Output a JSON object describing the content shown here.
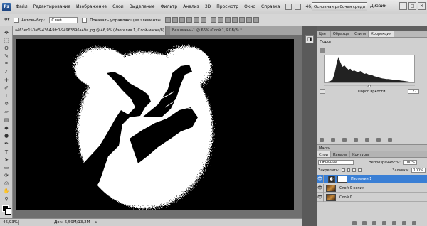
{
  "menubar": {
    "logo": "Ps",
    "items": [
      "Файл",
      "Редактирование",
      "Изображение",
      "Слои",
      "Выделение",
      "Фильтр",
      "Анализ",
      "3D",
      "Просмотр",
      "Окно",
      "Справка"
    ],
    "zoom": "46,9",
    "workspace_button": "Основная рабочая среда",
    "workspace_link": "Дизайн",
    "more": "»",
    "win_buttons": [
      "–",
      "□",
      "×"
    ]
  },
  "optbar": {
    "autoselect_label": "Автовыбор:",
    "autoselect_value": "Слой",
    "show_controls_label": "Показать управляющие элементы"
  },
  "toolbar": {
    "tools": [
      "move-tool",
      "marquee-tool",
      "lasso-tool",
      "quick-select-tool",
      "crop-tool",
      "eyedropper-tool",
      "healing-tool",
      "brush-tool",
      "stamp-tool",
      "history-brush-tool",
      "eraser-tool",
      "gradient-tool",
      "blur-tool",
      "dodge-tool",
      "pen-tool",
      "type-tool",
      "path-select-tool",
      "shape-tool",
      "3d-rotate-tool",
      "3d-orbit-tool",
      "hand-tool",
      "zoom-tool"
    ]
  },
  "document": {
    "tab_title": "a463ec1f-0af5-4364-9fc0-94963396a49a.jpg @ 46,9% (Изогелия 1, Слой-маска/8) *",
    "tab2_title": "Без имени-1 @ 66% (Слой 1, RGB/8) *"
  },
  "statusbar": {
    "zoom": "46,93%",
    "doc_info": "Док: 6,59M/13,2M"
  },
  "right_panel": {
    "tabs": [
      "Цвет",
      "Образцы",
      "Стили",
      "Коррекция"
    ],
    "active_tab": "Коррекция",
    "threshold_title": "Порог",
    "threshold_label": "Порог яркости:",
    "threshold_value": "127",
    "threshold_level": 0.5,
    "histogram": [
      0,
      0,
      3,
      5,
      10,
      30,
      65,
      90,
      70,
      55,
      60,
      52,
      45,
      48,
      40,
      42,
      38,
      36,
      40,
      34,
      30,
      32,
      28,
      26,
      25,
      22,
      20,
      18,
      16,
      14,
      13,
      12,
      12,
      11,
      10,
      10,
      9,
      8,
      7,
      6,
      5,
      4,
      3,
      2,
      2,
      1
    ]
  },
  "layers": {
    "masks_tab": "Маски",
    "tabs": [
      "Слои",
      "Каналы",
      "Контуры"
    ],
    "active_tab": "Слои",
    "blend_mode": "Обычные",
    "opacity_label": "Непрозрачность:",
    "opacity_value": "100%",
    "lock_label": "Закрепить:",
    "fill_label": "Заливка:",
    "fill_value": "100%",
    "rows": [
      {
        "name": "Изогелия 1",
        "active": true,
        "kind": "adjustment"
      },
      {
        "name": "Слой 0 копия",
        "active": false,
        "kind": "image"
      },
      {
        "name": "Слой 0",
        "active": false,
        "kind": "image"
      }
    ]
  }
}
